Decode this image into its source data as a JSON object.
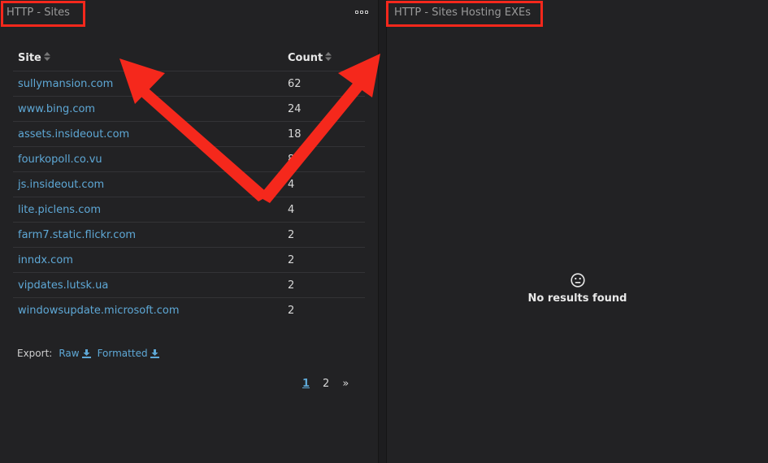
{
  "left_panel": {
    "title": "HTTP - Sites",
    "menu_icon": "more-options-icon",
    "table": {
      "headers": {
        "site": "Site",
        "count": "Count"
      },
      "rows": [
        {
          "site": "sullymansion.com",
          "count": "62"
        },
        {
          "site": "www.bing.com",
          "count": "24"
        },
        {
          "site": "assets.insideout.com",
          "count": "18"
        },
        {
          "site": "fourkopoll.co.vu",
          "count": "8"
        },
        {
          "site": "js.insideout.com",
          "count": "4"
        },
        {
          "site": "lite.piclens.com",
          "count": "4"
        },
        {
          "site": "farm7.static.flickr.com",
          "count": "2"
        },
        {
          "site": "inndx.com",
          "count": "2"
        },
        {
          "site": "vipdates.lutsk.ua",
          "count": "2"
        },
        {
          "site": "windowsupdate.microsoft.com",
          "count": "2"
        }
      ]
    },
    "export": {
      "label": "Export:",
      "raw": "Raw",
      "formatted": "Formatted"
    },
    "pagination": {
      "pages": [
        "1",
        "2"
      ],
      "current": "1",
      "next": "»"
    }
  },
  "right_panel": {
    "title": "HTTP - Sites Hosting EXEs",
    "empty_icon": "neutral-face-icon",
    "empty_message": "No results found"
  },
  "colors": {
    "background": "#222224",
    "link": "#5ea8d6",
    "annotation": "#f5281c"
  }
}
